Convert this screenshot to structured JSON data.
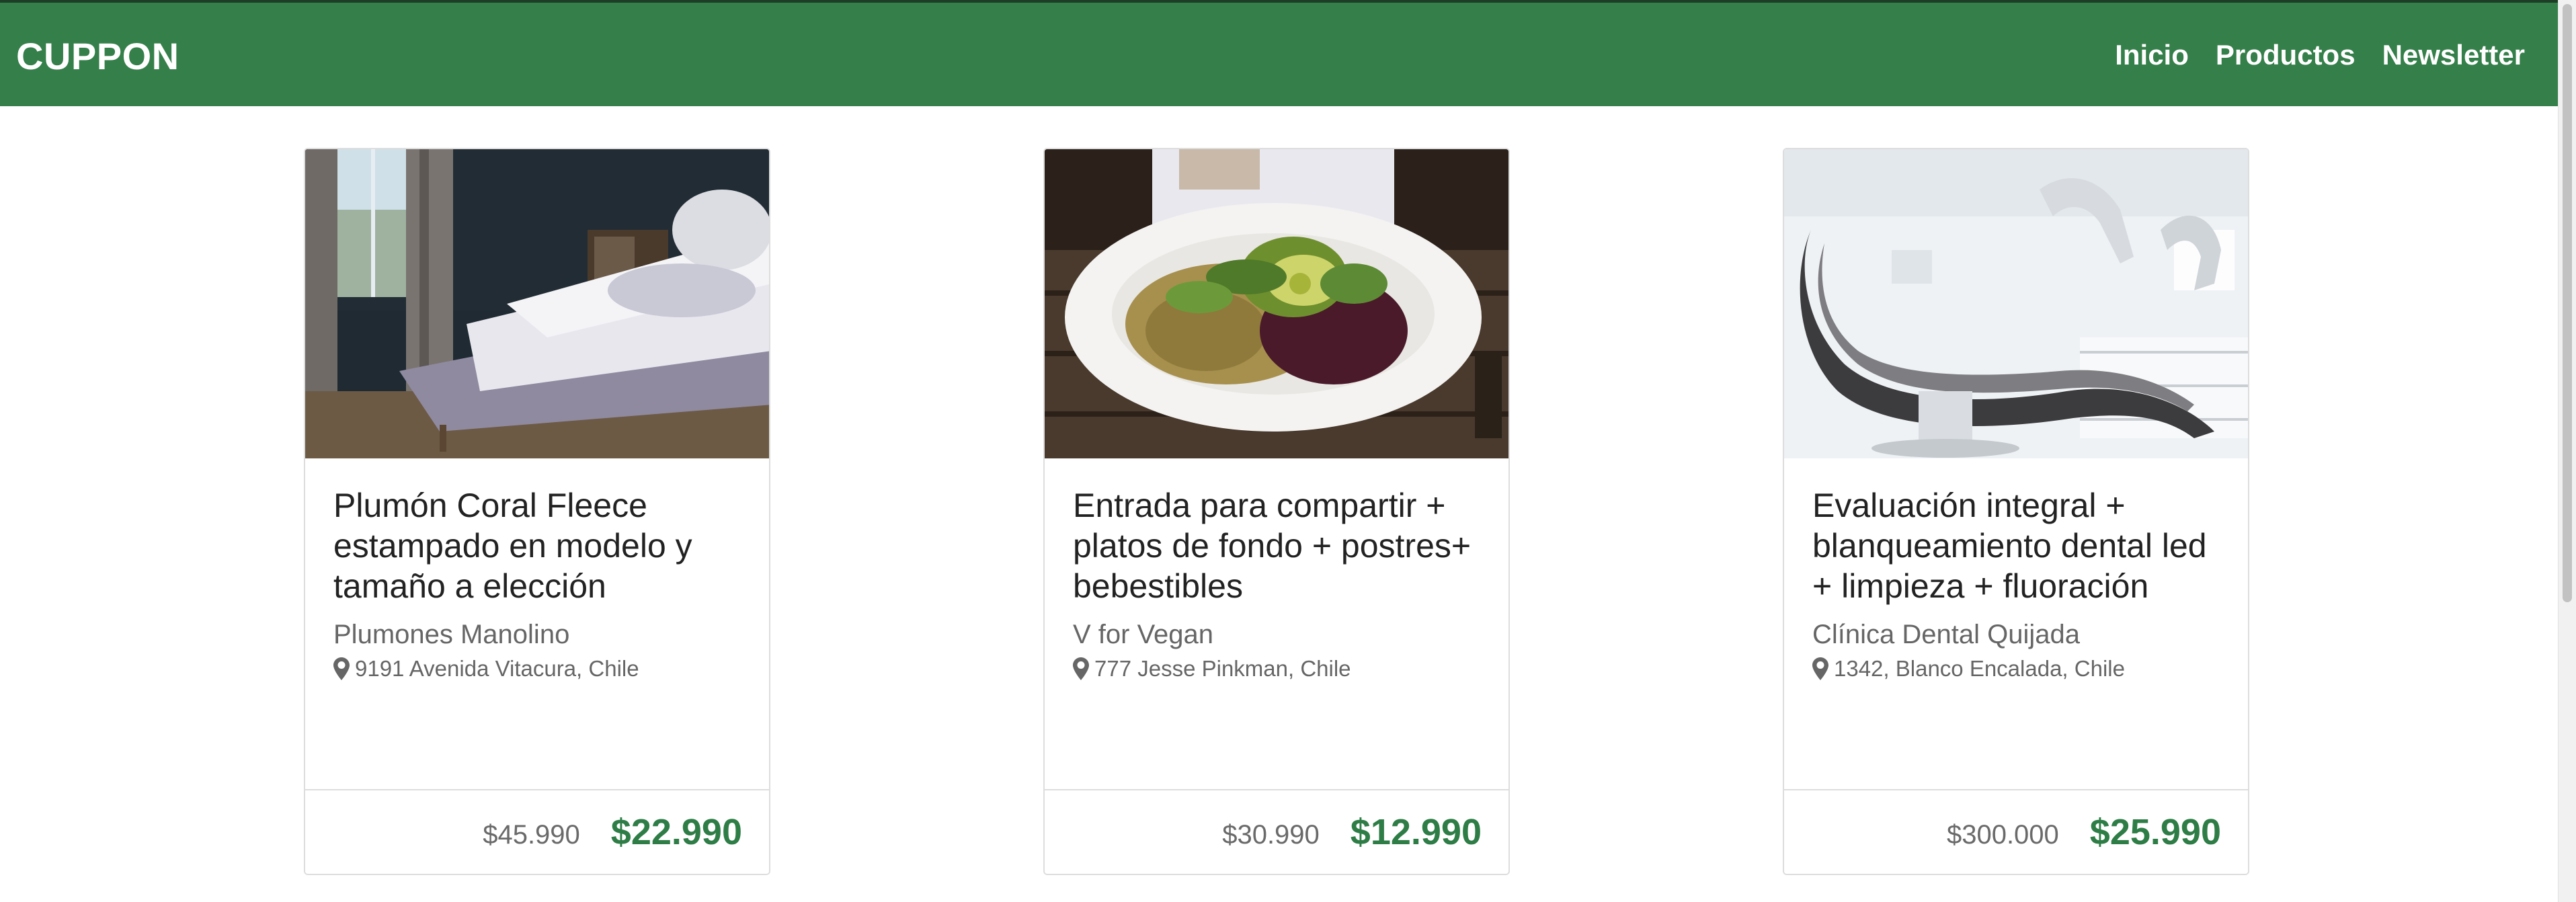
{
  "navbar": {
    "brand": "CUPPON",
    "links": [
      "Inicio",
      "Productos",
      "Newsletter"
    ],
    "color": "#357f4a"
  },
  "cards": [
    {
      "title": "Plumón Coral Fleece estampado en modelo y tamaño a elección",
      "company": "Plumones Manolino",
      "location": "9191 Avenida Vitacura, Chile",
      "old_price": "$45.990",
      "new_price": "$22.990",
      "image": "bedroom-photo"
    },
    {
      "title": "Entrada para compartir + platos de fondo + postres+ bebestibles",
      "company": "V for Vegan",
      "location": "777 Jesse Pinkman, Chile",
      "old_price": "$30.990",
      "new_price": "$12.990",
      "image": "salad-plate-photo"
    },
    {
      "title": "Evaluación integral + blanqueamiento dental led + limpieza + fluoración",
      "company": "Clínica Dental Quijada",
      "location": "1342, Blanco Encalada, Chile",
      "old_price": "$300.000",
      "new_price": "$25.990",
      "image": "dental-chair-photo"
    }
  ],
  "colors": {
    "price_accent": "#2e7d46",
    "icon": "map-marker-icon"
  }
}
